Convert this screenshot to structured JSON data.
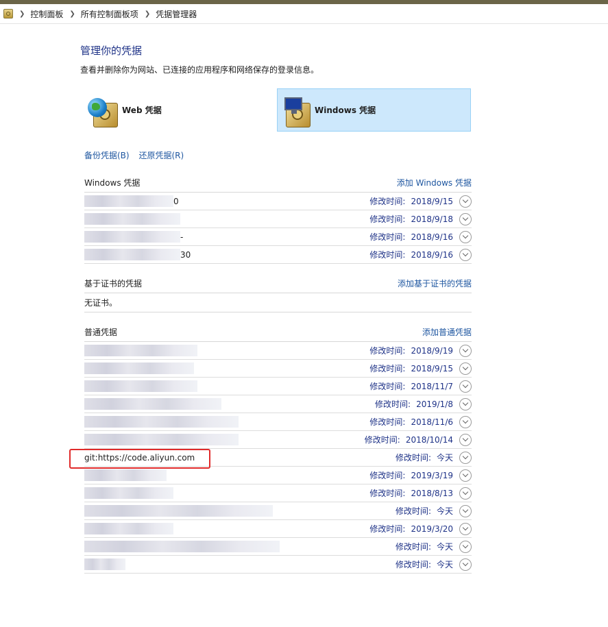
{
  "breadcrumb": [
    "控制面板",
    "所有控制面板项",
    "凭据管理器"
  ],
  "page": {
    "title": "管理你的凭据",
    "subtitle": "查看并删除你为网站、已连接的应用程序和网络保存的登录信息。"
  },
  "tiles": {
    "web": "Web 凭据",
    "windows": "Windows 凭据"
  },
  "links": {
    "backup": "备份凭据(B)",
    "restore": "还原凭据(R)"
  },
  "mod_label": "修改时间:",
  "windows_section": {
    "header": "Windows 凭据",
    "action": "添加 Windows 凭据",
    "rows": [
      {
        "name": "0",
        "date": "2018/9/15"
      },
      {
        "name": "",
        "date": "2018/9/18"
      },
      {
        "name": "-",
        "date": "2018/9/16"
      },
      {
        "name": "30",
        "date": "2018/9/16"
      }
    ]
  },
  "cert_section": {
    "header": "基于证书的凭据",
    "action": "添加基于证书的凭据",
    "empty": "无证书。"
  },
  "generic_section": {
    "header": "普通凭据",
    "action": "添加普通凭据",
    "rows": [
      {
        "name": "",
        "date": "2018/9/19"
      },
      {
        "name": "",
        "date": "2018/9/15"
      },
      {
        "name": "",
        "date": "2018/11/7"
      },
      {
        "name": "",
        "date": "2019/1/8"
      },
      {
        "name": "",
        "date": "2018/11/6"
      },
      {
        "name": "",
        "date": "2018/10/14"
      },
      {
        "name": "git:https://code.aliyun.com",
        "date": "今天"
      },
      {
        "name": "",
        "date": "2019/3/19"
      },
      {
        "name": "",
        "date": "2018/8/13"
      },
      {
        "name": "",
        "date": "今天"
      },
      {
        "name": "",
        "date": "2019/3/20"
      },
      {
        "name": "",
        "date": "今天"
      },
      {
        "name": "",
        "date": "今天"
      }
    ]
  }
}
